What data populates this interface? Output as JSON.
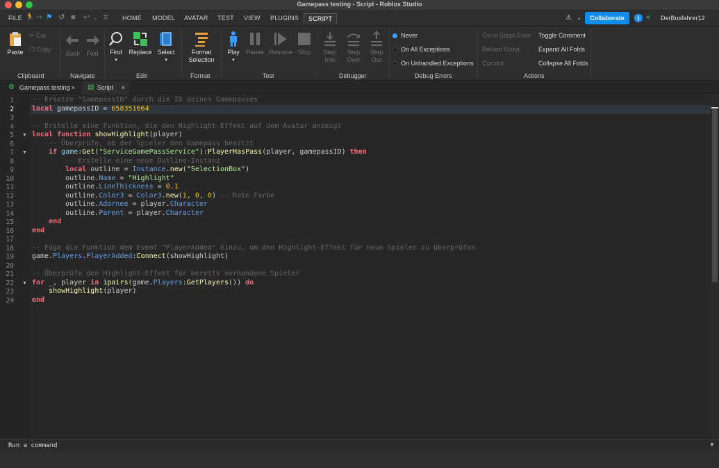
{
  "window": {
    "title": "Gamepass testing - Script - Roblox Studio"
  },
  "menu": {
    "file": "FILE",
    "tabs": [
      "HOME",
      "MODEL",
      "AVATAR",
      "TEST",
      "VIEW",
      "PLUGINS",
      "SCRIPT"
    ],
    "active_tab": "SCRIPT",
    "collaborate": "Collaborate",
    "user": "DerBusfahrer12"
  },
  "ribbon": {
    "clipboard": {
      "label": "Clipboard",
      "paste": "Paste",
      "cut": "Cut",
      "copy": "Copy"
    },
    "navigate": {
      "label": "Navigate",
      "back": "Back",
      "fwd": "Fwd"
    },
    "edit": {
      "label": "Edit",
      "find": "Find",
      "replace": "Replace",
      "select": "Select"
    },
    "format": {
      "label": "Format",
      "format_selection_1": "Format",
      "format_selection_2": "Selection"
    },
    "test": {
      "label": "Test",
      "play": "Play",
      "pause": "Pause",
      "resume": "Resume",
      "stop": "Stop"
    },
    "debugger": {
      "label": "Debugger",
      "step_into_1": "Step",
      "step_into_2": "Into",
      "step_over_1": "Step",
      "step_over_2": "Over",
      "step_out_1": "Step",
      "step_out_2": "Out"
    },
    "debug_errors": {
      "label": "Debug Errors",
      "never": "Never",
      "on_all": "On All Exceptions",
      "on_unhandled": "On Unhandled Exceptions"
    },
    "actions": {
      "label": "Actions",
      "goto_error": "Go to Script Error",
      "reload": "Reload Script",
      "commit": "Commit",
      "toggle_comment": "Toggle Comment",
      "expand_folds": "Expand All Folds",
      "collapse_folds": "Collapse All Folds"
    }
  },
  "tabs": [
    {
      "label": "Gamepass testing",
      "close": "×"
    },
    {
      "label": "Script",
      "close": "×"
    }
  ],
  "editor": {
    "line_numbers": [
      "1",
      "2",
      "3",
      "4",
      "5",
      "6",
      "7",
      "8",
      "9",
      "10",
      "11",
      "12",
      "13",
      "14",
      "15",
      "16",
      "17",
      "18",
      "19",
      "20",
      "21",
      "22",
      "23",
      "24"
    ],
    "current_line": "2",
    "lines": {
      "l1": "-- Ersetze \"GamepassID\" durch die ID deines Gamepasses",
      "l2_kw": "local",
      "l2_a": " gamepassID = ",
      "l2_num": "658351664",
      "l4": "-- Erstelle eine Funktion, die den Highlight-Effekt auf dem Avatar anzeigt",
      "l5_kw1": "local",
      "l5_kw2": " function",
      "l5_fn": " showHighlight",
      "l5_b": "(player)",
      "l6": "    -- Überprüfe, ob der Spieler den Gamepass besitzt",
      "l7_indent": "    ",
      "l7_kw": "if",
      "l7_g": " game",
      "l7_c": ":",
      "l7_fn": "Get",
      "l7_p1": "(",
      "l7_s": "\"ServiceGamePassService\"",
      "l7_p2": "):",
      "l7_fn2": "PlayerHasPass",
      "l7_p3": "(player, gamepassID) ",
      "l7_kw2": "then",
      "l8": "        -- Erstelle eine neue Outline-Instanz",
      "l9_indent": "        ",
      "l9_kw": "local",
      "l9_a": " outline = ",
      "l9_g": "Instance",
      "l9_dot": ".",
      "l9_fn": "new",
      "l9_p1": "(",
      "l9_s": "\"SelectionBox\"",
      "l9_p2": ")",
      "l10_a": "        outline.",
      "l10_p": "Name",
      "l10_b": " = ",
      "l10_s": "\"Highlight\"",
      "l11_a": "        outline.",
      "l11_p": "LineThickness",
      "l11_b": " = ",
      "l11_n": "0.1",
      "l12_a": "        outline.",
      "l12_p": "Color3",
      "l12_b": " = ",
      "l12_g": "Color3",
      "l12_dot": ".",
      "l12_fn": "new",
      "l12_p1": "(",
      "l12_n1": "1",
      "l12_c1": ", ",
      "l12_n2": "0",
      "l12_c2": ", ",
      "l12_n3": "0",
      "l12_p2": ") ",
      "l12_cm": "-- Rote Farbe",
      "l13_a": "        outline.",
      "l13_p": "Adornee",
      "l13_b": " = player.",
      "l13_p2": "Character",
      "l14_a": "        outline.",
      "l14_p": "Parent",
      "l14_b": " = player.",
      "l14_p2": "Character",
      "l15": "    end",
      "l16": "end",
      "l18": "-- Füge die Funktion dem Event \"PlayerAdded\" hinzu, um den Highlight-Effekt für neue Spieler zu überprüfen",
      "l19_a": "game.",
      "l19_p": "Players",
      "l19_dot": ".",
      "l19_p2": "PlayerAdded",
      "l19_c": ":",
      "l19_fn": "Connect",
      "l19_b": "(showHighlight)",
      "l21": "-- Überprüfe den Highlight-Effekt für bereits vorhandene Spieler",
      "l22_kw": "for",
      "l22_a": " _, player ",
      "l22_kw2": "in",
      "l22_fn": " ipairs",
      "l22_b": "(game.",
      "l22_p": "Players",
      "l22_c": ":",
      "l22_fn2": "GetPlayers",
      "l22_d": "()) ",
      "l22_kw3": "do",
      "l23_indent": "    ",
      "l23_fn": "showHighlight",
      "l23_b": "(player)",
      "l24": "end"
    }
  },
  "command_bar": {
    "placeholder": "Run a command"
  },
  "colors": {
    "accent": "#0d8df0",
    "keyword": "#f86d7c",
    "string": "#adf195",
    "number": "#ffc600",
    "comment": "#666666",
    "function": "#fdfbac",
    "property": "#61a1f1"
  }
}
